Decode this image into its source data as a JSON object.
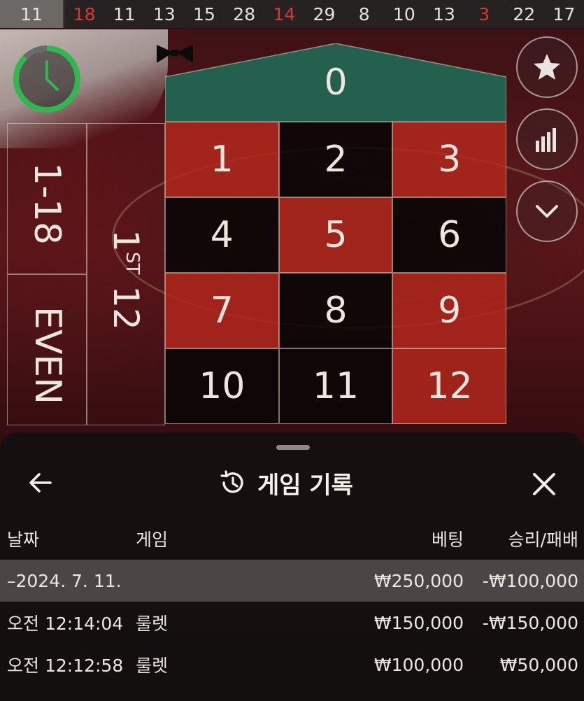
{
  "history_strip": {
    "numbers": [
      {
        "value": "11",
        "color": "#e7e2dc"
      },
      {
        "value": "18",
        "color": "#d23c2e"
      },
      {
        "value": "11",
        "color": "#e7e2dc"
      },
      {
        "value": "13",
        "color": "#e7e2dc"
      },
      {
        "value": "15",
        "color": "#e7e2dc"
      },
      {
        "value": "28",
        "color": "#e7e2dc"
      },
      {
        "value": "14",
        "color": "#d23c2e"
      },
      {
        "value": "29",
        "color": "#e7e2dc"
      },
      {
        "value": "8",
        "color": "#e7e2dc"
      },
      {
        "value": "10",
        "color": "#e7e2dc"
      },
      {
        "value": "13",
        "color": "#e7e2dc"
      },
      {
        "value": "3",
        "color": "#d23c2e"
      },
      {
        "value": "22",
        "color": "#e7e2dc"
      },
      {
        "value": "17",
        "color": "#e7e2dc"
      }
    ]
  },
  "timer": {
    "icon": "clock-icon",
    "accent": "#2fb84f"
  },
  "side_buttons": [
    {
      "icon": "star-icon"
    },
    {
      "icon": "statistics-icon"
    },
    {
      "icon": "chevron-down-icon"
    }
  ],
  "table": {
    "zero": "0",
    "zero_color": "#1f6b55",
    "cells": [
      {
        "n": "1",
        "color": "red"
      },
      {
        "n": "2",
        "color": "black"
      },
      {
        "n": "3",
        "color": "red"
      },
      {
        "n": "4",
        "color": "black"
      },
      {
        "n": "5",
        "color": "red"
      },
      {
        "n": "6",
        "color": "black"
      },
      {
        "n": "7",
        "color": "red"
      },
      {
        "n": "8",
        "color": "black"
      },
      {
        "n": "9",
        "color": "red"
      },
      {
        "n": "10",
        "color": "black"
      },
      {
        "n": "11",
        "color": "black"
      },
      {
        "n": "12",
        "color": "red"
      }
    ],
    "outside": {
      "low": "1-18",
      "even": "EVEN",
      "dozen_number": "1",
      "dozen_suffix": "ST",
      "dozen_value": "12"
    }
  },
  "panel": {
    "title": "게임 기록",
    "columns": {
      "date": "날짜",
      "game": "게임",
      "bet": "베팅",
      "result": "승리/패배"
    },
    "date_group": {
      "date": "–2024. 7. 11.",
      "bet": "₩250,000",
      "result": "-₩100,000"
    },
    "rows": [
      {
        "time": "오전 12:14:04",
        "game": "룰렛",
        "bet": "₩150,000",
        "result": "-₩150,000"
      },
      {
        "time": "오전 12:12:58",
        "game": "룰렛",
        "bet": "₩100,000",
        "result": "₩50,000"
      }
    ]
  }
}
